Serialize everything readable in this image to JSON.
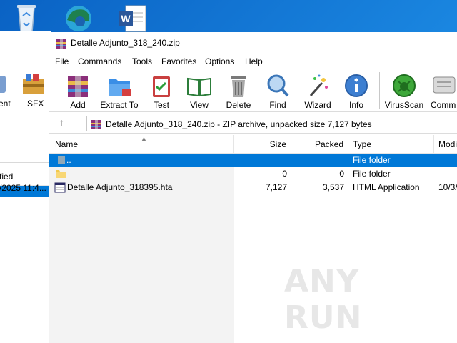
{
  "background_window": {
    "toolbar": [
      "ent",
      "SFX"
    ],
    "header": "fied",
    "date": "/2025 11:4..."
  },
  "window": {
    "title": "Detalle Adjunto_318_240.zip"
  },
  "menu": [
    "File",
    "Commands",
    "Tools",
    "Favorites",
    "Options",
    "Help"
  ],
  "toolbar": [
    {
      "label": "Add",
      "icon": "add-archive-icon"
    },
    {
      "label": "Extract To",
      "icon": "extract-folder-icon"
    },
    {
      "label": "Test",
      "icon": "test-clipboard-icon"
    },
    {
      "label": "View",
      "icon": "view-book-icon"
    },
    {
      "label": "Delete",
      "icon": "delete-bin-icon"
    },
    {
      "label": "Find",
      "icon": "find-magnifier-icon"
    },
    {
      "label": "Wizard",
      "icon": "wizard-wand-icon"
    },
    {
      "label": "Info",
      "icon": "info-icon"
    },
    {
      "label": "VirusScan",
      "icon": "virusscan-icon"
    },
    {
      "label": "Comm",
      "icon": "comment-icon"
    }
  ],
  "address": {
    "path": "Detalle Adjunto_318_240.zip - ZIP archive, unpacked size 7,127 bytes"
  },
  "columns": [
    "Name",
    "Size",
    "Packed",
    "Type",
    "Modi"
  ],
  "rows": [
    {
      "name": "..",
      "size": "",
      "packed": "",
      "type": "File folder",
      "modified": ""
    },
    {
      "name": "",
      "size": "0",
      "packed": "0",
      "type": "File folder",
      "modified": ""
    },
    {
      "name": "Detalle Adjunto_318395.hta",
      "size": "7,127",
      "packed": "3,537",
      "type": "HTML Application",
      "modified": "10/3/"
    }
  ],
  "watermark": "ANY RUN",
  "colors": {
    "selection": "#0078d7",
    "desktop": "#1279d6"
  }
}
